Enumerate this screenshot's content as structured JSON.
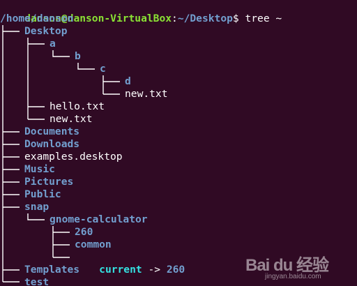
{
  "terminal": {
    "prompt": {
      "user_host": "danson@danson-VirtualBox",
      "separator": ":",
      "path": "~/Desktop",
      "symbol": "$",
      "command": " tree ~"
    },
    "root": "/home/danson",
    "tree": [
      {
        "name": "Desktop",
        "kind": "dir"
      },
      {
        "name": "a",
        "kind": "dir"
      },
      {
        "name": "b",
        "kind": "dir"
      },
      {
        "name": "c",
        "kind": "dir"
      },
      {
        "name": "d",
        "kind": "dir"
      },
      {
        "name": "new.txt",
        "kind": "file"
      },
      {
        "name": "hello.txt",
        "kind": "file"
      },
      {
        "name": "new.txt",
        "kind": "file"
      },
      {
        "name": "Documents",
        "kind": "dir"
      },
      {
        "name": "Downloads",
        "kind": "dir"
      },
      {
        "name": "examples.desktop",
        "kind": "file"
      },
      {
        "name": "Music",
        "kind": "dir"
      },
      {
        "name": "Pictures",
        "kind": "dir"
      },
      {
        "name": "Public",
        "kind": "dir"
      },
      {
        "name": "snap",
        "kind": "dir"
      },
      {
        "name": "gnome-calculator",
        "kind": "dir"
      },
      {
        "name": "260",
        "kind": "dir"
      },
      {
        "name": "common",
        "kind": "dir"
      },
      {
        "name": "current",
        "kind": "link",
        "target": "260",
        "arrow": " -> "
      },
      {
        "name": "Templates",
        "kind": "dir"
      },
      {
        "name": "test",
        "kind": "dir"
      }
    ],
    "colors": {
      "background": "#300a24",
      "user_host": "#8ae234",
      "directory": "#729fcf",
      "symlink": "#34e2e2",
      "text": "#ffffff"
    }
  },
  "watermark": {
    "logo": "Bai du 经验",
    "url": "jingyan.baidu.com"
  }
}
